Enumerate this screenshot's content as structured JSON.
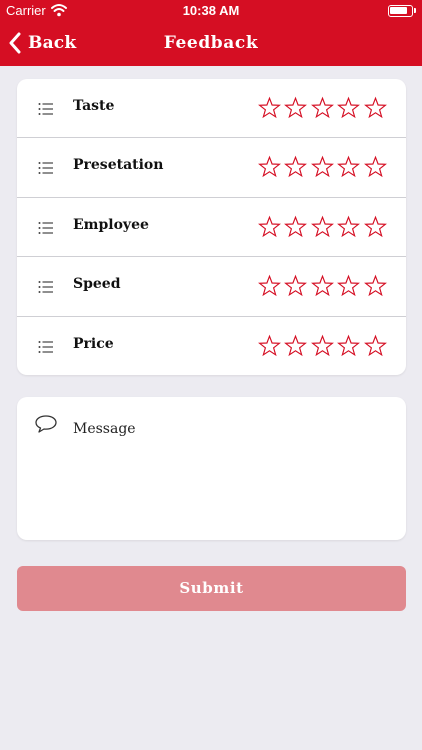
{
  "status_bar": {
    "carrier": "Carrier",
    "time": "10:38 AM",
    "battery_level": 0.85
  },
  "nav": {
    "back_label": "Back",
    "title": "Feedback"
  },
  "ratings": [
    {
      "label": "Taste",
      "stars": 0,
      "max_stars": 5
    },
    {
      "label": "Presetation",
      "stars": 0,
      "max_stars": 5
    },
    {
      "label": "Employee",
      "stars": 0,
      "max_stars": 5
    },
    {
      "label": "Speed",
      "stars": 0,
      "max_stars": 5
    },
    {
      "label": "Price",
      "stars": 0,
      "max_stars": 5
    }
  ],
  "message": {
    "placeholder": "Message",
    "value": ""
  },
  "submit": {
    "label": "Submit"
  },
  "icons": {
    "row_icon": "list-icon",
    "star": "star-outline-icon",
    "message_icon": "chat-bubble-icon",
    "back_icon": "chevron-left-icon"
  },
  "colors": {
    "brand": "#d50e23",
    "background": "#ecebf1",
    "star_outline": "#d50e23",
    "submit_disabled": "#e0898f"
  }
}
